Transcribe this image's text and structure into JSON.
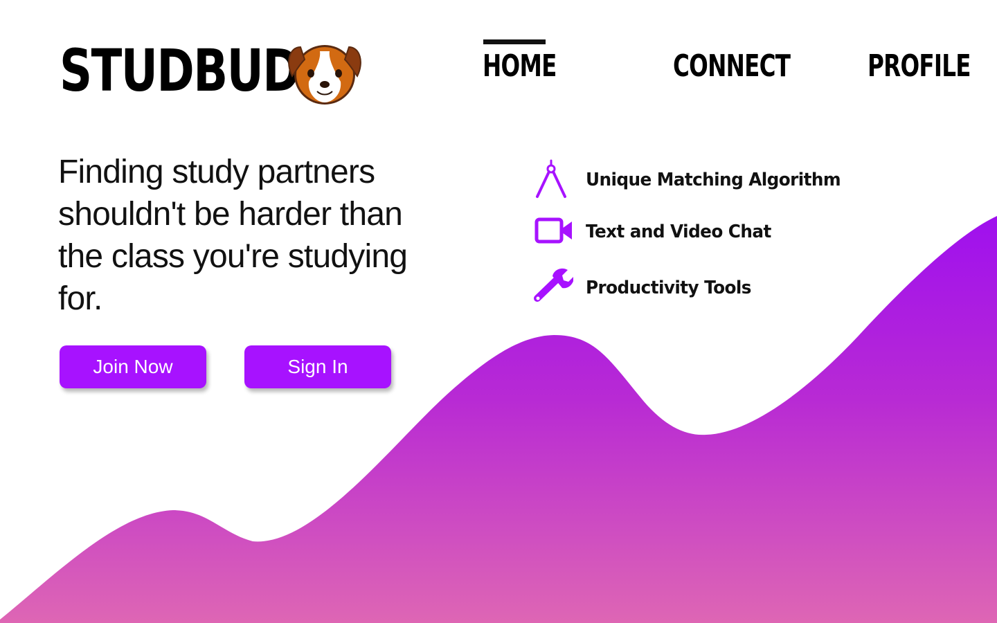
{
  "brand": {
    "name": "STUDBUD",
    "mascot_icon": "dog-face-icon"
  },
  "nav": {
    "items": [
      {
        "label": "HOME",
        "active": true
      },
      {
        "label": "CONNECT",
        "active": false
      },
      {
        "label": "PROFILE",
        "active": false
      }
    ]
  },
  "hero": {
    "tagline": "Finding study partners shouldn't be harder than the class you're studying for.",
    "join_button": "Join Now",
    "signin_button": "Sign In"
  },
  "features": [
    {
      "icon": "compass-icon",
      "label": "Unique Matching Algorithm"
    },
    {
      "icon": "video-camera-icon",
      "label": "Text and Video Chat"
    },
    {
      "icon": "wrench-icon",
      "label": "Productivity Tools"
    }
  ],
  "colors": {
    "accent": "#a712ff",
    "wave_top": "#a112ee",
    "wave_bottom": "#dc64b4",
    "text": "#111111"
  }
}
